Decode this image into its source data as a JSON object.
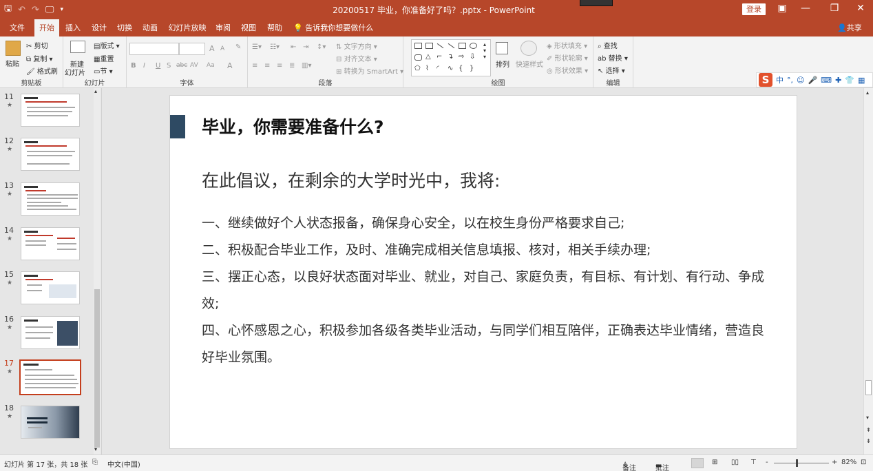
{
  "titlebar": {
    "qat": {
      "save_icon": "save-icon",
      "undo_icon": "undo-icon",
      "redo_icon": "redo-icon",
      "present_icon": "slideshow-icon",
      "customize_icon": "chevron-down-icon"
    },
    "title": "20200517 毕业，你准备好了吗？.pptx - PowerPoint",
    "login_label": "登录",
    "ribbon_display_icon": "ribbon-display-icon",
    "minimize_icon": "minimize-icon",
    "restore_icon": "restore-icon",
    "close_icon": "close-icon"
  },
  "tabs": [
    "文件",
    "开始",
    "插入",
    "设计",
    "切换",
    "动画",
    "幻灯片放映",
    "审阅",
    "视图",
    "帮助"
  ],
  "active_tab": "开始",
  "tellme": "告诉我你想要做什么",
  "share": "共享",
  "ribbon": {
    "clipboard": {
      "label": "剪贴板",
      "paste": "粘贴",
      "cut": "剪切",
      "copy": "复制",
      "format_painter": "格式刷"
    },
    "slides": {
      "label": "幻灯片",
      "new_slide_line1": "新建",
      "new_slide_line2": "幻灯片",
      "layout": "版式",
      "reset": "重置",
      "section": "节"
    },
    "font": {
      "label": "字体",
      "font_name": "",
      "font_size": "",
      "bold": "B",
      "italic": "I",
      "underline": "U",
      "shadow": "S",
      "strike": "abc",
      "spacing": "AV",
      "case": "Aa",
      "color": "A",
      "grow": "A",
      "shrink": "A"
    },
    "paragraph": {
      "label": "段落",
      "text_direction": "文字方向",
      "align_text": "对齐文本",
      "smartart": "转换为 SmartArt"
    },
    "drawing": {
      "label": "绘图",
      "arrange": "排列",
      "quick_styles": "快速样式",
      "shape_fill": "形状填充",
      "shape_outline": "形状轮廓",
      "shape_effects": "形状效果"
    },
    "editing": {
      "label": "编辑",
      "find": "查找",
      "replace": "替换",
      "select": "选择"
    }
  },
  "ime": {
    "logo": "S",
    "mode": "中",
    "punct": "°,"
  },
  "thumbnails": [
    {
      "num": "11",
      "star": "★"
    },
    {
      "num": "12",
      "star": "★"
    },
    {
      "num": "13",
      "star": "★"
    },
    {
      "num": "14",
      "star": "★"
    },
    {
      "num": "15",
      "star": "★"
    },
    {
      "num": "16",
      "star": "★"
    },
    {
      "num": "17",
      "star": "★"
    },
    {
      "num": "18",
      "star": "★"
    }
  ],
  "current_slide": "17",
  "slide": {
    "title": "毕业，你需要准备什么?",
    "subtitle": "在此倡议，在剩余的大学时光中，我将:",
    "items": [
      "一、继续做好个人状态报备，确保身心安全，以在校生身份严格要求自己;",
      "二、积极配合毕业工作，及时、准确完成相关信息填报、核对，相关手续办理;",
      "三、摆正心态，以良好状态面对毕业、就业，对自己、家庭负责，有目标、有计划、有行动、争成效;",
      "四、心怀感恩之心，积极参加各级各类毕业活动，与同学们相互陪伴，正确表达毕业情绪，营造良好毕业氛围。"
    ]
  },
  "status": {
    "slide_info": "幻灯片 第 17 张，共 18 张",
    "language": "中文(中国)",
    "notes": "备注",
    "comments": "批注",
    "zoom": "82%",
    "zoom_minus": "-",
    "zoom_plus": "+"
  },
  "colors": {
    "accent": "#b7472a",
    "title_block": "#2e4a63",
    "current_thumb": "#c43e1c"
  }
}
